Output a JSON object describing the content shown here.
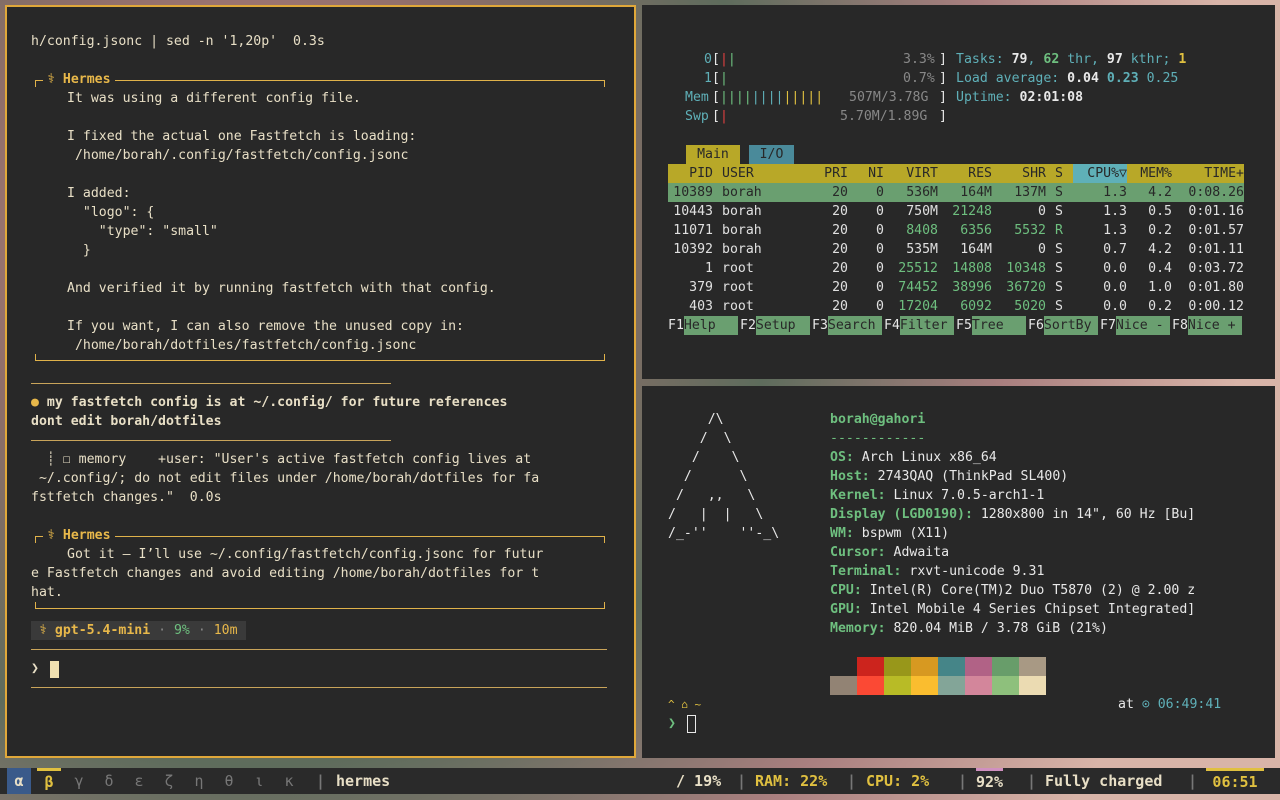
{
  "left": {
    "cmd_line": "h/config.jsonc | sed -n '1,20p'  0.3s",
    "hermes_label": "⚕ Hermes",
    "msg1": [
      "It was using a different config file.",
      "",
      "I fixed the actual one Fastfetch is loading:",
      " /home/borah/.config/fastfetch/config.jsonc",
      "",
      "I added:",
      "  \"logo\": {",
      "    \"type\": \"small\"",
      "  }",
      "",
      "And verified it by running fastfetch with that config.",
      "",
      "If you want, I can also remove the unused copy in:",
      " /home/borah/dotfiles/fastfetch/config.jsonc"
    ],
    "user_msg_line1": "● my fastfetch config is at ~/.config/ for future references",
    "user_msg_line2": "dont edit borah/dotfiles",
    "memory_line1": "  ┊ ☐ memory    +user: \"User's active fastfetch config lives at",
    "memory_line2": " ~/.config/; do not edit files under /home/borah/dotfiles for fa",
    "memory_line3": "fstfetch changes.\"  0.0s",
    "msg2": [
      "Got it — I’ll use ~/.config/fastfetch/config.jsonc for futur",
      "e Fastfetch changes and avoid editing /home/borah/dotfiles for t",
      "hat."
    ],
    "model": "⚕ gpt-5.4-mini",
    "ctx": "9%",
    "time": "10m",
    "prompt": "❯"
  },
  "htop": {
    "cpu0_label": "0",
    "cpu0_pct": "3.3%",
    "cpu1_label": "1",
    "cpu1_pct": "0.7%",
    "mem_label": "Mem",
    "mem_val": "507M/3.78G",
    "swp_label": "Swp",
    "swp_val": "5.70M/1.89G",
    "tasks_label": "Tasks:",
    "tasks": "79",
    "thr": "62",
    "kthr": "97",
    "running": "1",
    "load_label": "Load average:",
    "load1": "0.04",
    "load5": "0.23",
    "load15": "0.25",
    "uptime_label": "Uptime:",
    "uptime": "02:01:08",
    "tab_main": "Main",
    "tab_io": "I/O",
    "headers": [
      "PID",
      "USER",
      "PRI",
      "NI",
      "VIRT",
      "RES",
      "SHR",
      "S",
      "CPU%▽",
      "MEM%",
      "TIME+"
    ],
    "rows": [
      [
        "10389",
        "borah",
        "20",
        "0",
        "536M",
        "164M",
        "137M",
        "S",
        "1.3",
        "4.2",
        "0:08.26"
      ],
      [
        "10443",
        "borah",
        "20",
        "0",
        "750M",
        "21248",
        "0",
        "S",
        "1.3",
        "0.5",
        "0:01.16"
      ],
      [
        "11071",
        "borah",
        "20",
        "0",
        "8408",
        "6356",
        "5532",
        "R",
        "1.3",
        "0.2",
        "0:01.57"
      ],
      [
        "10392",
        "borah",
        "20",
        "0",
        "535M",
        "164M",
        "0",
        "S",
        "0.7",
        "4.2",
        "0:01.11"
      ],
      [
        "1",
        "root",
        "20",
        "0",
        "25512",
        "14808",
        "10348",
        "S",
        "0.0",
        "0.4",
        "0:03.72"
      ],
      [
        "379",
        "root",
        "20",
        "0",
        "74452",
        "38996",
        "36720",
        "S",
        "0.0",
        "1.0",
        "0:01.80"
      ],
      [
        "403",
        "root",
        "20",
        "0",
        "17204",
        "6092",
        "5020",
        "S",
        "0.0",
        "0.2",
        "0:00.12"
      ]
    ],
    "fkeys": [
      [
        "F1",
        "Help"
      ],
      [
        "F2",
        "Setup"
      ],
      [
        "F3",
        "Search"
      ],
      [
        "F4",
        "Filter"
      ],
      [
        "F5",
        "Tree"
      ],
      [
        "F6",
        "SortBy"
      ],
      [
        "F7",
        "Nice -"
      ],
      [
        "F8",
        "Nice +"
      ]
    ]
  },
  "fastfetch": {
    "logo": [
      "     /\\",
      "    /  \\",
      "   /    \\",
      "  /      \\",
      " /   ,,   \\",
      "/   |  |   \\",
      "/_-''    ''-_\\"
    ],
    "user_host": "borah@gahori",
    "sep": "------------",
    "info": [
      [
        "OS:",
        " Arch Linux x86_64"
      ],
      [
        "Host:",
        " 2743QAQ (ThinkPad SL400)"
      ],
      [
        "Kernel:",
        " Linux 7.0.5-arch1-1"
      ],
      [
        "Display (LGD0190):",
        " 1280x800 in 14\", 60 Hz [Bu]"
      ],
      [
        "WM:",
        " bspwm (X11)"
      ],
      [
        "Cursor:",
        " Adwaita"
      ],
      [
        "Terminal:",
        " rxvt-unicode 9.31"
      ],
      [
        "CPU:",
        " Intel(R) Core(TM)2 Duo T5870 (2) @ 2.00 z"
      ],
      [
        "GPU:",
        " Intel Mobile 4 Series Chipset Integrated]"
      ],
      [
        "Memory:",
        " 820.04 MiB / 3.78 GiB (21%)"
      ]
    ],
    "palette_top": [
      "#282828",
      "#cc241d",
      "#98971a",
      "#d79921",
      "#458588",
      "#b16286",
      "#689d6a",
      "#a89984"
    ],
    "palette_bot": [
      "#928374",
      "#fb4934",
      "#b8bb26",
      "#fabd2f",
      "#83a598",
      "#d3869b",
      "#8ec07c",
      "#ebdbb2"
    ],
    "prompt_dir": "^ ⌂ ~",
    "at_label": "at",
    "clock": "⊙ 06:49:41",
    "prompt": "❯"
  },
  "bar": {
    "workspaces": [
      "α",
      "β",
      "γ",
      "δ",
      "ε",
      "ζ",
      "η",
      "θ",
      "ι",
      "κ"
    ],
    "title": "hermes",
    "disk": "/ 19%",
    "ram": "RAM: 22%",
    "cpu": "CPU:  2%",
    "battery": "92%",
    "battery_status": "Fully charged",
    "time": "06:51"
  }
}
